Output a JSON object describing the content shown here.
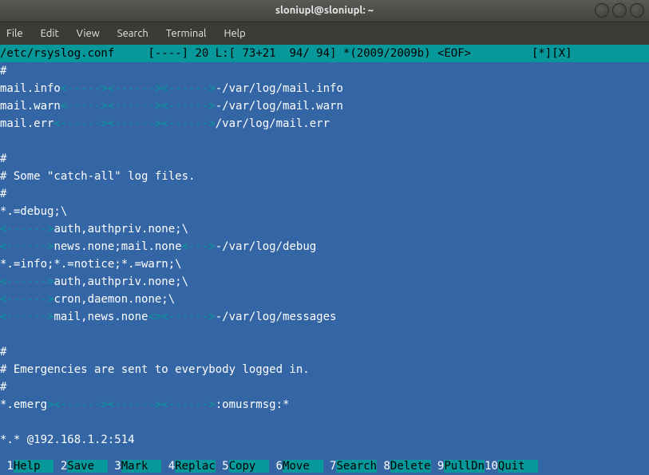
{
  "window": {
    "title": "sloniupl@sloniupl: ~"
  },
  "menubar": {
    "items": [
      {
        "label": "File"
      },
      {
        "label": "Edit"
      },
      {
        "label": "View"
      },
      {
        "label": "Search"
      },
      {
        "label": "Terminal"
      },
      {
        "label": "Help"
      }
    ]
  },
  "status": {
    "file": "/etc/rsyslog.conf",
    "gap1": "     ",
    "flags": "[----]",
    "gap2": " ",
    "col": "20 L:[ 73+21  94/ 94]",
    "gap3": " ",
    "charset": "*(2009/2009b)",
    "gap4": " ",
    "eof": "<EOF>",
    "tail_pad": "         ",
    "tail": "[*][X]"
  },
  "body": {
    "l0": "#",
    "l1a": "mail.info",
    "l1b": "<-----><------><------>",
    "l1c": "-/var/log/mail.info",
    "l2a": "mail.warn",
    "l2b": "<-----><------><------>",
    "l2c": "-/var/log/mail.warn",
    "l3a": "mail.err",
    "l3b": "<------><------><------>",
    "l3c": "/var/log/mail.err",
    "l4": "",
    "l5": "#",
    "l6": "# Some \"catch-all\" log files.",
    "l7": "#",
    "l8": "*.=debug;\\",
    "l9a": "<------>",
    "l9b": "auth,authpriv.none;\\",
    "l10a": "<------>",
    "l10b": "news.none;mail.none",
    "l10c": "<--->",
    "l10d": "-/var/log/debug",
    "l11": "*.=info;*.=notice;*.=warn;\\",
    "l12a": "<------>",
    "l12b": "auth,authpriv.none;\\",
    "l13a": "<------>",
    "l13b": "cron,daemon.none;\\",
    "l14a": "<------>",
    "l14b": "mail,news.none",
    "l14c": "<><------>",
    "l14d": "-/var/log/messages",
    "l15": "",
    "l16": "#",
    "l17": "# Emergencies are sent to everybody logged in.",
    "l18": "#",
    "l19a": "*.emerg",
    "l19b": "><------><------><------>",
    "l19c": ":omusrmsg:*",
    "l20": "",
    "l21": "*.* @192.168.1.2:514"
  },
  "footer": {
    "keys": [
      {
        "num": " 1",
        "label": "Help  "
      },
      {
        "num": " 2",
        "label": "Save  "
      },
      {
        "num": " 3",
        "label": "Mark  "
      },
      {
        "num": " 4",
        "label": "Replac"
      },
      {
        "num": " 5",
        "label": "Copy  "
      },
      {
        "num": " 6",
        "label": "Move  "
      },
      {
        "num": " 7",
        "label": "Search"
      },
      {
        "num": " 8",
        "label": "Delete"
      },
      {
        "num": " 9",
        "label": "PullDn"
      },
      {
        "num": "10",
        "label": "Quit  "
      }
    ]
  }
}
